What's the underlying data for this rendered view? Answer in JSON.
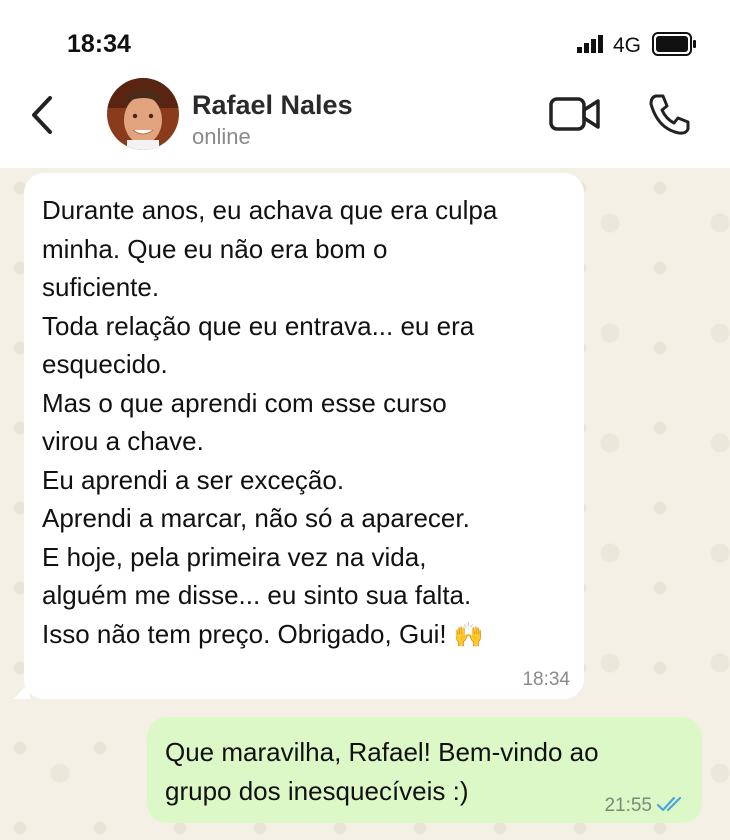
{
  "status_bar": {
    "time": "18:34",
    "network": "4G",
    "icons": [
      "signal-icon",
      "battery-icon"
    ]
  },
  "header": {
    "back_icon": "chevron-left-icon",
    "contact_name": "Rafael Nales",
    "contact_status": "online",
    "video_icon": "video-camera-icon",
    "call_icon": "phone-icon"
  },
  "messages": [
    {
      "direction": "incoming",
      "lines": [
        "Durante anos, eu achava que era culpa",
        "minha. Que eu não era bom o",
        "suficiente.",
        "Toda relação que eu entrava... eu era",
        "esquecido.",
        "Mas o que aprendi com esse curso",
        "virou a chave.",
        "Eu aprendi a ser exceção.",
        "Aprendi a marcar, não só a aparecer.",
        "E hoje, pela primeira vez na vida,",
        "alguém me disse... eu sinto sua falta.",
        "Isso não tem preço. Obrigado, Gui!"
      ],
      "emoji": "🙌",
      "time": "18:34"
    },
    {
      "direction": "outgoing",
      "lines": [
        "Que maravilha, Rafael! Bem-vindo ao",
        "grupo dos inesquecíveis :)"
      ],
      "time": "21:55",
      "read_icon": "double-check-icon",
      "read_color": "#4fa3e0"
    }
  ],
  "colors": {
    "incoming_bubble": "#ffffff",
    "outgoing_bubble": "#dcf8c6",
    "chat_background": "#f4f0e6"
  }
}
